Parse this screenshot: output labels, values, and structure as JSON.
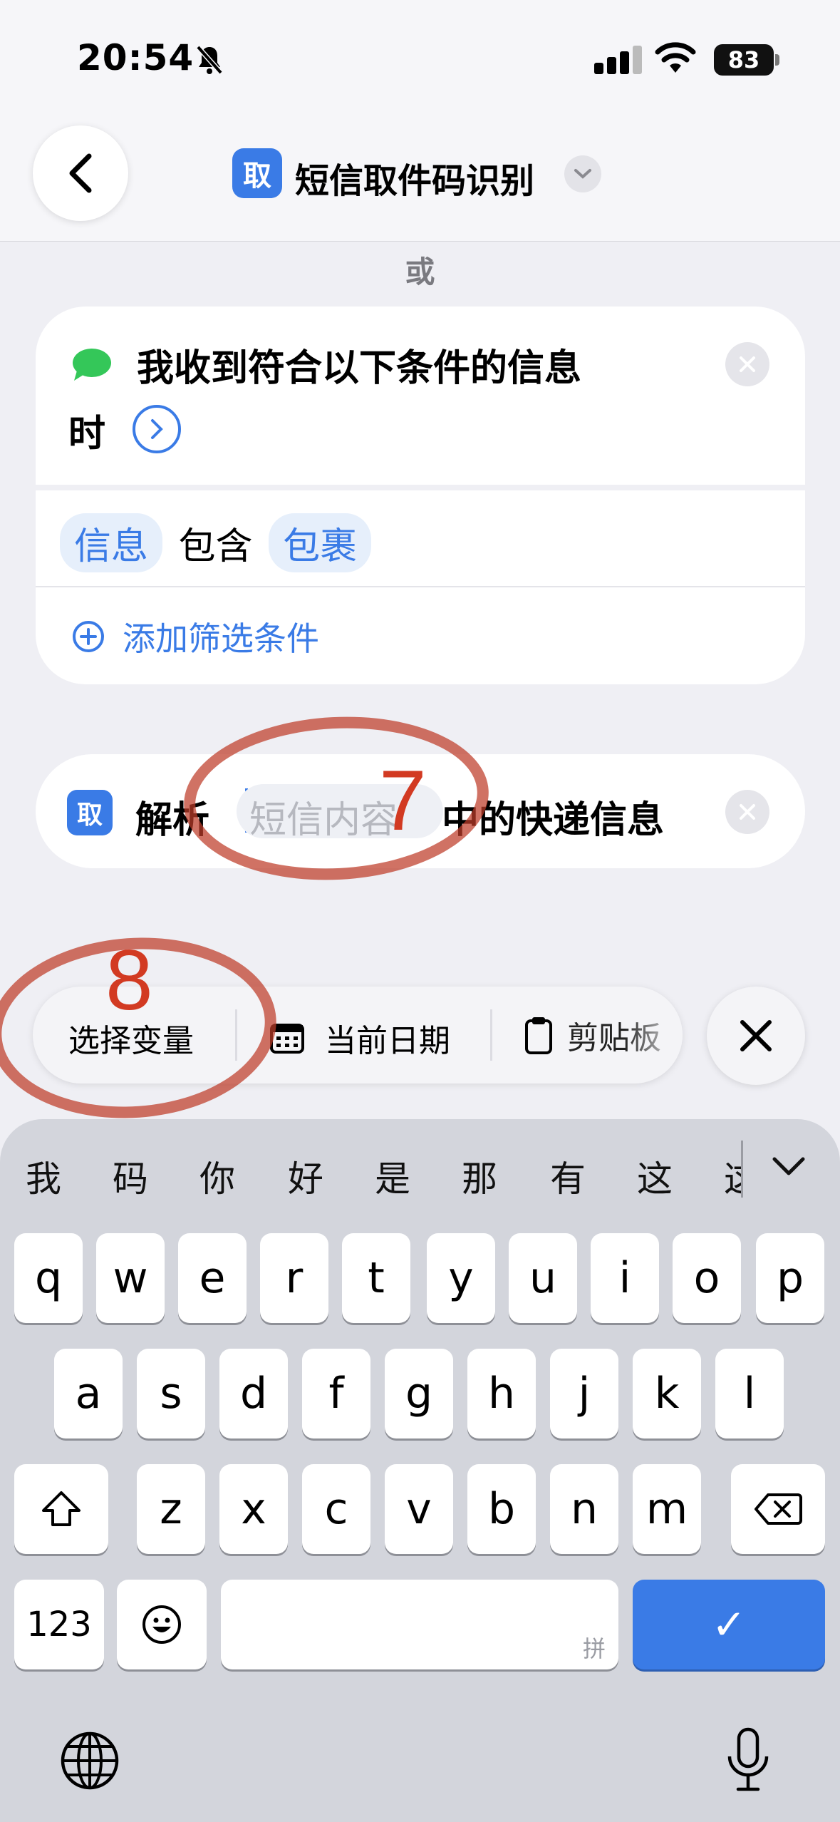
{
  "status_bar": {
    "time": "20:54",
    "battery": "83"
  },
  "nav": {
    "title": "短信取件码识别",
    "app_icon_char": "取"
  },
  "separator_label": "或",
  "trigger_card": {
    "line1": "我收到符合以下条件的信息",
    "line2": "时",
    "condition": {
      "field": "信息",
      "operator": "包含",
      "value": "包裹"
    },
    "add_filter_label": "添加筛选条件"
  },
  "action_card": {
    "app_icon_char": "取",
    "verb": "解析",
    "placeholder": "短信内容",
    "suffix": "中的快递信息"
  },
  "suggestions": {
    "items": [
      {
        "label": "选择变量"
      },
      {
        "label": "当前日期",
        "icon": "calendar-icon"
      },
      {
        "label": "剪贴板",
        "icon": "clipboard-icon"
      }
    ]
  },
  "keyboard": {
    "candidates": [
      "我",
      "码",
      "你",
      "好",
      "是",
      "那",
      "有",
      "这",
      "这"
    ],
    "row1": [
      "q",
      "w",
      "e",
      "r",
      "t",
      "y",
      "u",
      "i",
      "o",
      "p"
    ],
    "row2": [
      "a",
      "s",
      "d",
      "f",
      "g",
      "h",
      "j",
      "k",
      "l"
    ],
    "row3": [
      "z",
      "x",
      "c",
      "v",
      "b",
      "n",
      "m"
    ],
    "numbers_label": "123",
    "space_hint": "拼",
    "return_symbol": "✓"
  },
  "annotations": {
    "marker_7": "7",
    "marker_8": "8"
  },
  "colors": {
    "accent": "#3a7be6",
    "annotation": "#c03a28",
    "messages_green": "#34c759"
  }
}
